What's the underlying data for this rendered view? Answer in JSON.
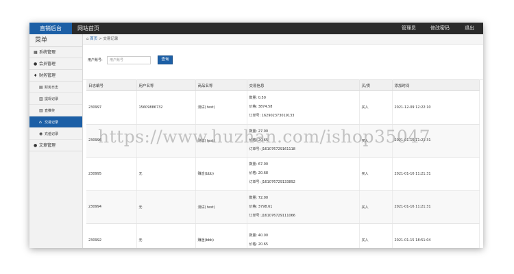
{
  "topbar": {
    "brand": "直销后台",
    "home_link": "网站首页",
    "admin": "管理员",
    "change_password": "修改密码",
    "logout": "退出"
  },
  "sidebar": {
    "title": "菜单",
    "groups": [
      {
        "label": "系统管理",
        "icon": "grid-icon"
      },
      {
        "label": "会员管理",
        "icon": "user-icon"
      },
      {
        "label": "财务管理",
        "icon": "tint-icon"
      }
    ],
    "finance_items": [
      {
        "label": "财务日志",
        "icon": "book-icon"
      },
      {
        "label": "提现记录",
        "icon": "bank-icon"
      },
      {
        "label": "直推奖",
        "icon": "bank-icon"
      },
      {
        "label": "交易记录",
        "icon": "home-icon",
        "active": true
      },
      {
        "label": "充值记录",
        "icon": "dashboard-icon"
      }
    ],
    "last_group": {
      "label": "文章管理",
      "icon": "user-icon"
    }
  },
  "breadcrumb": {
    "home": "首页",
    "sep": ">",
    "current": "交易记录"
  },
  "search": {
    "label": "用户账号:",
    "placeholder": "用户账号",
    "button": "查询"
  },
  "table": {
    "headers": [
      "日志编号",
      "用户名称",
      "商品名称",
      "交易信息",
      "买/卖",
      "添加时间"
    ],
    "rows": [
      {
        "id": "230997",
        "user": "15609886732",
        "product": "测试( test)",
        "qty": "数量: 0.50",
        "price": "价格: 3874.58",
        "order": "订单号: 162902373019133",
        "side": "买入",
        "time": "2021-12-09 12:22:10"
      },
      {
        "id": "230996",
        "user": "",
        "product": "测试( test)",
        "qty": "数量: 27.00",
        "price": "价格: 20.65",
        "order": "订单号: J161076729161118",
        "side": "买入",
        "time": "2021-01-16 11:21:31"
      },
      {
        "id": "230995",
        "user": "无",
        "product": "赚途(bbb)",
        "qty": "数量: 67.00",
        "price": "价格: 20.68",
        "order": "订单号: J161076729133892",
        "side": "买入",
        "time": "2021-01-16 11:21:31"
      },
      {
        "id": "230994",
        "user": "无",
        "product": "测试( test)",
        "qty": "数量: 72.00",
        "price": "价格: 3798.61",
        "order": "订单号: J161076729111066",
        "side": "买入",
        "time": "2021-01-16 11:21:31"
      },
      {
        "id": "230992",
        "user": "无",
        "product": "赚途(bbb)",
        "qty": "数量: 40.00",
        "price": "价格: 20.65",
        "order": "",
        "side": "买入",
        "time": "2021-01-15 18:51:04"
      }
    ]
  },
  "watermark": "https://www.huzhan.com/ishop35047",
  "colors": {
    "accent": "#1c5fa6",
    "topbar": "#2a2a2a",
    "sidebar": "#f2f2f2"
  }
}
